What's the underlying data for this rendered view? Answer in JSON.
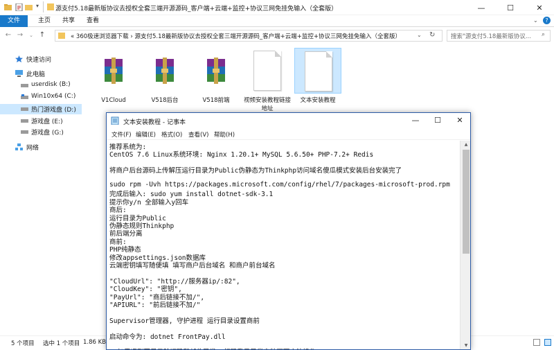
{
  "explorer": {
    "title": "源支付5.18最新版协议去授权全套三端开源源码_客户端+云端+监控+协议三网免挂免输入（全套版）",
    "window_controls": {
      "minimize": "—",
      "maximize": "☐",
      "close": "✕"
    },
    "ribbon_tabs": {
      "file": "文件",
      "home": "主页",
      "share": "共享",
      "view": "查看"
    },
    "address": {
      "chevron": "«",
      "segments": [
        "360极速浏览器下载",
        "源支付5.18最新版协议去授权全套三端开源源码_客户端+云端+监控+协议三网免挂免输入（全套版）"
      ],
      "separator": "›"
    },
    "search_placeholder": "搜索\"源支付5.18最新版协议...",
    "nav": {
      "quick_access": "快速访问",
      "this_pc": "此电脑",
      "drives": [
        "userdisk (B:)",
        "Win10x64 (C:)",
        "热门游戏盘 (D:)",
        "游戏盘 (E:)",
        "游戏盘 (G:)"
      ],
      "network": "网络"
    },
    "files": [
      {
        "name": "V1Cloud",
        "type": "rar"
      },
      {
        "name": "V518后台",
        "type": "rar"
      },
      {
        "name": "V518前端",
        "type": "rar"
      },
      {
        "name": "视频安装教程链接地址",
        "type": "txt"
      },
      {
        "name": "文本安装教程",
        "type": "txt",
        "selected": true
      }
    ],
    "status": {
      "count": "5 个项目",
      "selected": "选中 1 个项目",
      "size": "1.86 KB"
    }
  },
  "notepad": {
    "title": "文本安装教程 - 记事本",
    "menu": [
      "文件(F)",
      "编辑(E)",
      "格式(O)",
      "查看(V)",
      "帮助(H)"
    ],
    "lines": [
      "推荐系统为:",
      "CentOS 7.6 Linux系统环境: Nginx 1.20.1+ MySQL 5.6.50+ PHP-7.2+ Redis",
      "",
      "将商户后台源码上传解压运行目录为Public伪静态为Thinkphp访问域名傻瓜模式安装后台安装完了",
      "",
      "sudo rpm -Uvh https://packages.microsoft.com/config/rhel/7/packages-microsoft-prod.rpm",
      "完成后输入: sudo yum install dotnet-sdk-3.1",
      "提示你y/n 全部输入y回车",
      "商后:",
      "运行目录为Public",
      "伪静态规则Thinkphp",
      "前后端分离",
      "商前:",
      "PHP纯静态",
      "修改appsettings.json数据库",
      "云端密钥填写随便填  填写商户后台域名 和商户前台域名",
      "",
      "    \"CloudUrl\": \"http://服务器ip/:82\",",
      "    \"CloudKey\": \"密钥\",",
      "    \"PayUrl\": \"商后链接不加/\",",
      "    \"APIURL\": \"前后链接不加/\"",
      "",
      "Supervisor管理器, 守护进程 运行目录设置商前",
      "",
      "启动命令为: dotnet FrontPay.dll",
      "",
      "//如果遇到不显示验证码和邮件异常, 扫码登录异常安装下面方法操作"
    ]
  },
  "colors": {
    "accent": "#1979ca",
    "selection": "#cce8ff",
    "notepad_border": "#2b5aa6"
  }
}
